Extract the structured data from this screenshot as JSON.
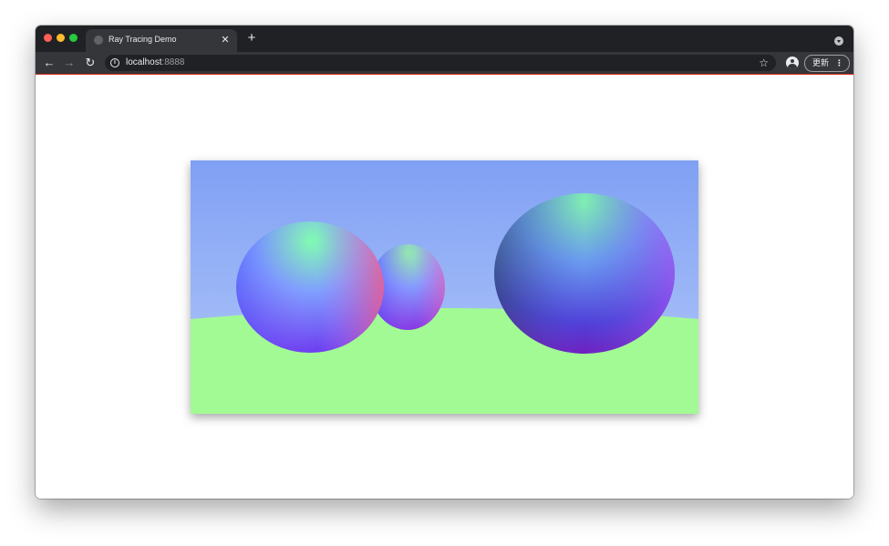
{
  "window": {
    "tab": {
      "title": "Ray Tracing Demo",
      "favicon": "globe-icon",
      "close_icon": "close-icon"
    },
    "new_tab_icon": "plus-icon",
    "tabstrip_menu_icon": "chevron-down-icon"
  },
  "toolbar": {
    "back_icon": "arrow-left-icon",
    "forward_icon": "arrow-right-icon",
    "reload_icon": "reload-icon",
    "url_host": "localhost",
    "url_port": ":8888",
    "info_icon": "info-icon",
    "bookmark_icon": "star-icon",
    "profile_icon": "account-circle-icon",
    "update_label": "更新",
    "menu_icon": "kebab-menu-icon"
  },
  "colors": {
    "chrome_dark": "#202124",
    "chrome_toolbar": "#35363a",
    "sky_top": "#80a0f4",
    "sky_bottom": "#b3c9f9",
    "ground": "#a2fa94",
    "loading_bar": "#d93025"
  }
}
